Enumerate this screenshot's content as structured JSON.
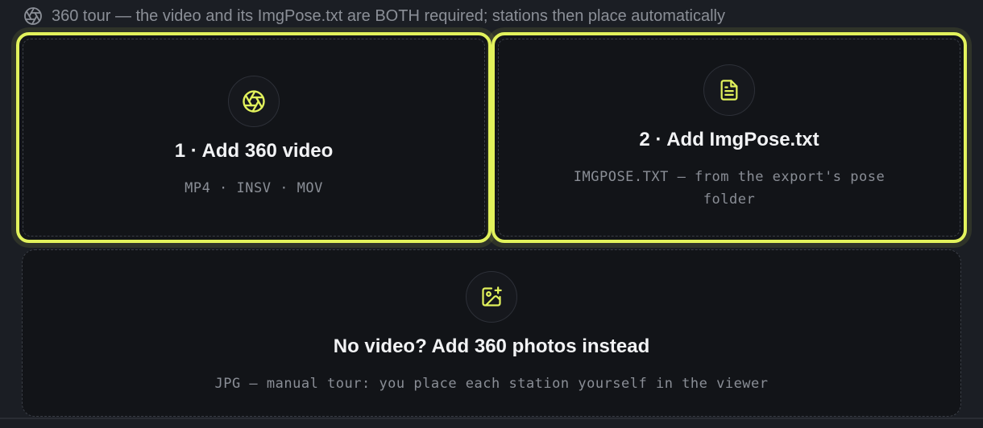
{
  "header": {
    "icon": "aperture-icon",
    "text": "360 tour — the video and its ImgPose.txt are BOTH required; stations then place automatically"
  },
  "cards": {
    "video": {
      "icon": "aperture-icon",
      "title": "1 · Add 360 video",
      "subtitle": "MP4 · INSV · MOV"
    },
    "pose": {
      "icon": "file-text-icon",
      "title": "2 · Add ImgPose.txt",
      "subtitle": "IMGPOSE.TXT — from the export's pose folder"
    },
    "photos": {
      "icon": "image-plus-icon",
      "title": "No video? Add 360 photos instead",
      "subtitle": "JPG — manual tour: you place each station yourself in the viewer"
    }
  },
  "colors": {
    "accent": "#e2f25c",
    "background": "#1b1e24",
    "card": "#121418",
    "muted": "#8a8e96"
  }
}
